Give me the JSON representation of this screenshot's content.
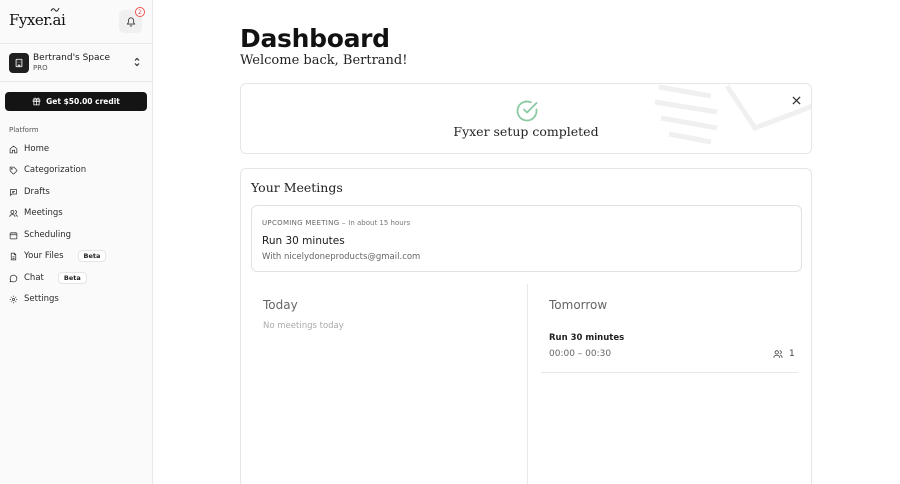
{
  "app": {
    "logo_text": "Fyxer.ai",
    "notification_count": "2"
  },
  "workspace": {
    "name": "Bertrand's Space",
    "plan": "PRO"
  },
  "credit_button": {
    "label": "Get $50.00 credit"
  },
  "nav": {
    "section_label": "Platform",
    "items": [
      {
        "label": "Home",
        "icon": "home-icon"
      },
      {
        "label": "Categorization",
        "icon": "tag-icon"
      },
      {
        "label": "Drafts",
        "icon": "drafts-icon"
      },
      {
        "label": "Meetings",
        "icon": "users-icon"
      },
      {
        "label": "Scheduling",
        "icon": "calendar-icon"
      },
      {
        "label": "Your Files",
        "icon": "file-icon",
        "badge": "Beta"
      },
      {
        "label": "Chat",
        "icon": "chat-icon",
        "badge": "Beta"
      },
      {
        "label": "Settings",
        "icon": "gear-icon"
      }
    ]
  },
  "page": {
    "title": "Dashboard",
    "subtitle": "Welcome back, Bertrand!"
  },
  "setup": {
    "message": "Fyxer setup completed"
  },
  "meetings": {
    "title": "Your Meetings",
    "upcoming": {
      "label": "UPCOMING MEETING",
      "separator": " – ",
      "time_until": "In about 15 hours",
      "name": "Run 30 minutes",
      "with": "With nicelydoneproducts@gmail.com"
    },
    "today": {
      "title": "Today",
      "empty_text": "No meetings today"
    },
    "tomorrow": {
      "title": "Tomorrow",
      "items": [
        {
          "name": "Run 30 minutes",
          "time": "00:00 – 00:30",
          "attendees": "1"
        }
      ]
    }
  },
  "colors": {
    "check_green": "#8bc9a3",
    "badge_red": "#e25555",
    "primary_dark": "#141414"
  }
}
